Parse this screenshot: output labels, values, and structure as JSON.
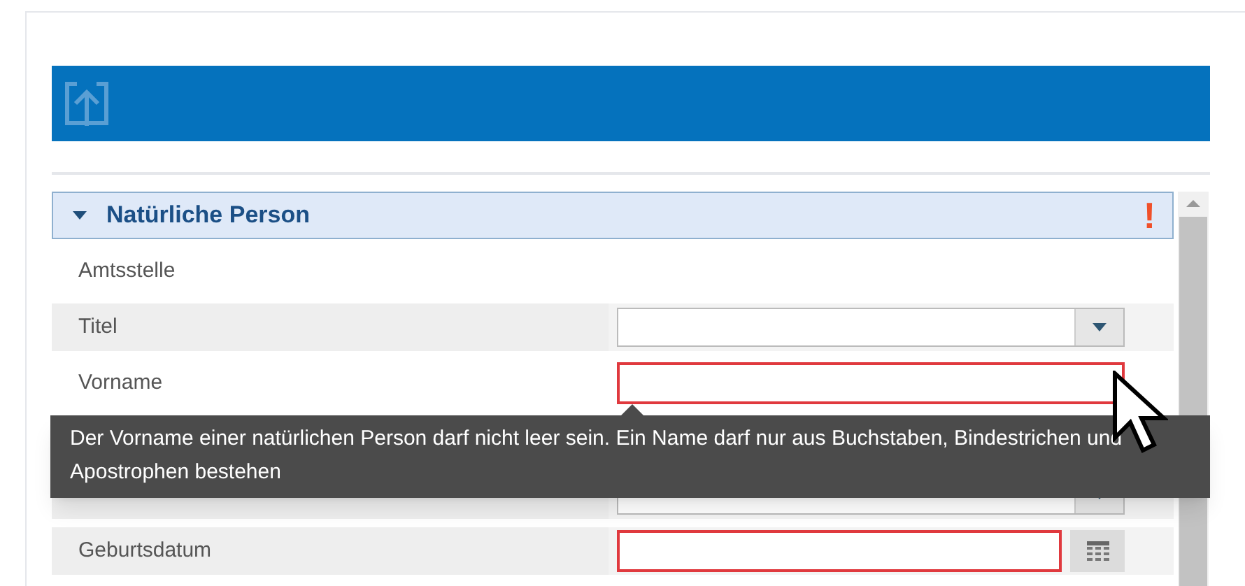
{
  "section": {
    "title": "Natürliche Person",
    "expanded": true,
    "error": true,
    "error_mark": "!"
  },
  "rows": [
    {
      "label": "Amtsstelle",
      "kind": "none"
    },
    {
      "label": "Titel",
      "kind": "dropdown",
      "invalid": false
    },
    {
      "label": "Vorname",
      "kind": "text",
      "invalid": true
    },
    {
      "kind": "hidden"
    },
    {
      "kind": "dropdown",
      "invalid": false
    },
    {
      "label": "Geburtsdatum",
      "kind": "date",
      "invalid": true
    }
  ],
  "tooltip": {
    "text": "Der Vorname einer natürlichen Person darf nicht leer sein. Ein Name darf nur aus Buchstaben, Bindestrichen und Apostrophen bestehen"
  }
}
